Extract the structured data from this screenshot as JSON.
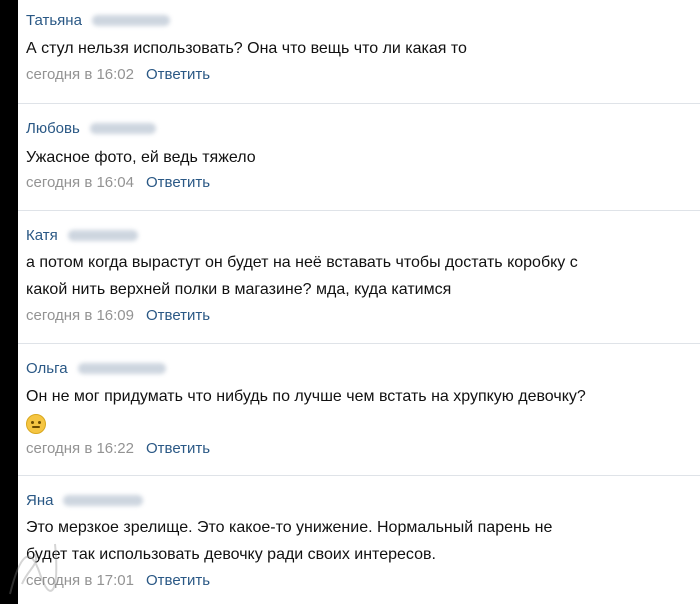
{
  "comments": [
    {
      "author": "Татьяна",
      "lines": [
        "А стул нельзя использовать? Она что вещь что ли какая то"
      ],
      "time": "сегодня в 16:02",
      "reply": "Ответить"
    },
    {
      "author": "Любовь",
      "lines": [
        "Ужасное фото, ей ведь тяжело"
      ],
      "time": "сегодня в 16:04",
      "reply": "Ответить"
    },
    {
      "author": "Катя",
      "lines": [
        "а потом когда вырастут он будет на неё вставать чтобы достать коробку с",
        "какой нить верхней полки в магазине? мда, куда катимся"
      ],
      "time": "сегодня в 16:09",
      "reply": "Ответить"
    },
    {
      "author": "Ольга",
      "lines": [
        "Он не мог придумать что нибудь по лучше чем встать на хрупкую девочку?"
      ],
      "emoji": "neutral-face-emoji",
      "time": "сегодня в 16:22",
      "reply": "Ответить"
    },
    {
      "author": "Яна",
      "lines": [
        "Это мерзкое зрелище. Это какое-то унижение. Нормальный парень не",
        "будет так использовать девочку ради своих интересов."
      ],
      "time": "сегодня в 17:01",
      "reply": "Ответить"
    }
  ],
  "colors": {
    "link": "#2a5885",
    "meta": "#939393",
    "divider": "#dfe3e8"
  }
}
